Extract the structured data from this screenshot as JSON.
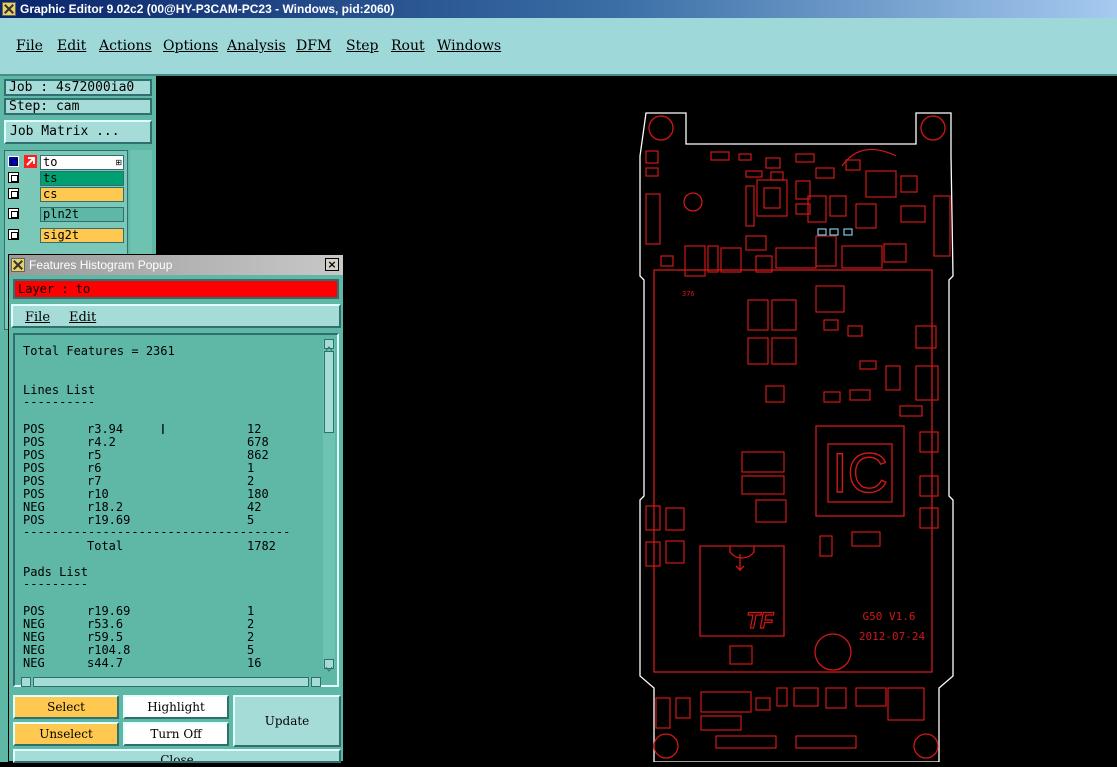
{
  "window": {
    "title": "Graphic Editor 9.02c2 (00@HY-P3CAM-PC23 - Windows, pid:2060)"
  },
  "menu": {
    "items": [
      "File",
      "Edit",
      "Actions",
      "Options",
      "Analysis",
      "DFM",
      "Step",
      "Rout",
      "Windows"
    ]
  },
  "left_panel": {
    "job": "Job : 4s72000ia0",
    "step": "Step: cam",
    "job_matrix": "Job Matrix ...",
    "layers": [
      {
        "name": "to",
        "color": "#ffffff"
      },
      {
        "name": "ts",
        "color": "#00a070"
      },
      {
        "name": "cs",
        "color": "#ffc850"
      },
      {
        "name": "pln2t",
        "color": "#5fb8a6"
      },
      {
        "name": "sig2t",
        "color": "#ffc850"
      }
    ]
  },
  "popup": {
    "title": "Features Histogram Popup",
    "layer": "Layer :  to",
    "menu": [
      "File",
      "Edit"
    ],
    "total": "Total Features = 2361",
    "lines_heading": "Lines List",
    "lines_sep": "----------",
    "lines": [
      {
        "pol": "POS",
        "sym": "r3.94",
        "count": "12"
      },
      {
        "pol": "POS",
        "sym": "r4.2",
        "count": "678"
      },
      {
        "pol": "POS",
        "sym": "r5",
        "count": "862"
      },
      {
        "pol": "POS",
        "sym": "r6",
        "count": "1"
      },
      {
        "pol": "POS",
        "sym": "r7",
        "count": "2"
      },
      {
        "pol": "POS",
        "sym": "r10",
        "count": "180"
      },
      {
        "pol": "NEG",
        "sym": "r18.2",
        "count": "42"
      },
      {
        "pol": "POS",
        "sym": "r19.69",
        "count": "5"
      }
    ],
    "total_line": "-------------------------------------",
    "lines_total_label": "Total",
    "lines_total": "1782",
    "pads_heading": "Pads List",
    "pads_sep": "---------",
    "pads": [
      {
        "pol": "POS",
        "sym": "r19.69",
        "count": "1"
      },
      {
        "pol": "NEG",
        "sym": "r53.6",
        "count": "2"
      },
      {
        "pol": "NEG",
        "sym": "r59.5",
        "count": "2"
      },
      {
        "pol": "NEG",
        "sym": "r104.8",
        "count": "5"
      },
      {
        "pol": "NEG",
        "sym": "s44.7",
        "count": "16"
      }
    ],
    "buttons": {
      "select": "Select",
      "highlight": "Highlight",
      "update": "Update",
      "unselect": "Unselect",
      "turn_off": "Turn Off",
      "close": "Close"
    }
  },
  "board": {
    "ic_label": "IC",
    "tf_label": "TF",
    "version": "G50 V1.6",
    "date": "2012-07-24",
    "ref_label": "376",
    "colors": {
      "outline": "#ffffff",
      "copper": "#d01818",
      "highlight": "#7ec8e0"
    }
  }
}
